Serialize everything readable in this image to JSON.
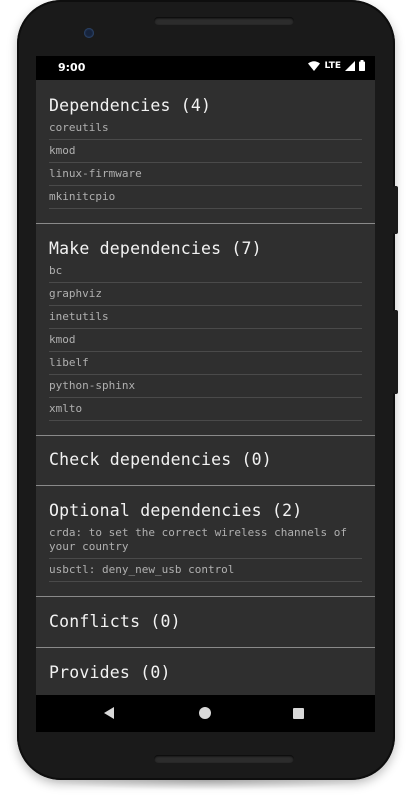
{
  "status_bar": {
    "time": "9:00",
    "network": "LTE",
    "icons": [
      "wifi-icon",
      "signal-icon",
      "battery-icon"
    ]
  },
  "sections": [
    {
      "title": "Dependencies (4)",
      "items": [
        "coreutils",
        "kmod",
        "linux-firmware",
        "mkinitcpio"
      ]
    },
    {
      "title": "Make dependencies (7)",
      "items": [
        "bc",
        "graphviz",
        "inetutils",
        "kmod",
        "libelf",
        "python-sphinx",
        "xmlto"
      ]
    },
    {
      "title": "Check dependencies (0)",
      "items": []
    },
    {
      "title": "Optional dependencies (2)",
      "items": [
        "crda: to set the correct wireless channels of your country",
        "usbctl: deny_new_usb control"
      ]
    },
    {
      "title": "Conflicts (0)",
      "items": []
    },
    {
      "title": "Provides (0)",
      "items": []
    }
  ],
  "nav_bar": {
    "buttons": [
      "back-icon",
      "home-icon",
      "recents-icon"
    ]
  },
  "colors": {
    "background": "#2f2f2f",
    "title_text": "#f2f2f2",
    "item_text": "#b0b0b0",
    "divider": "#8a8a8a"
  }
}
